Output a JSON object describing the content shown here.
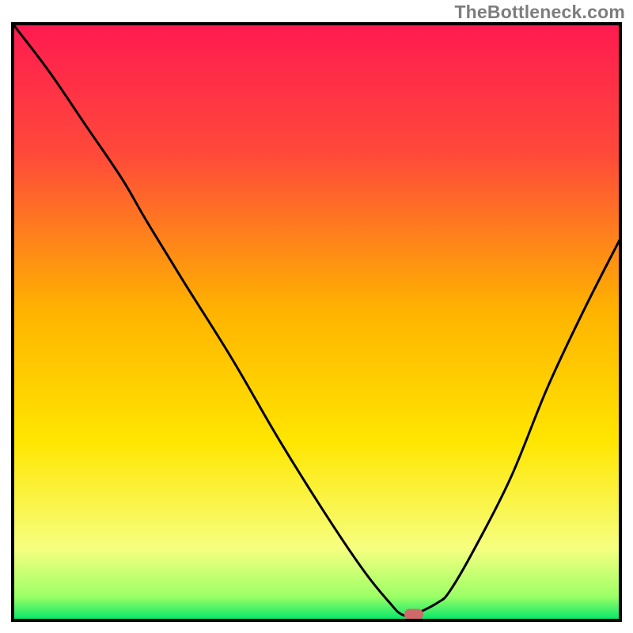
{
  "watermark": "TheBottleneck.com",
  "chart_data": {
    "type": "line",
    "title": "",
    "xlabel": "",
    "ylabel": "",
    "xlim": [
      0,
      100
    ],
    "ylim": [
      0,
      100
    ],
    "background": {
      "kind": "vertical-gradient",
      "stops": [
        {
          "pct": 0,
          "color": "#ff1a50"
        },
        {
          "pct": 22,
          "color": "#ff4a3a"
        },
        {
          "pct": 48,
          "color": "#ffb300"
        },
        {
          "pct": 70,
          "color": "#ffe600"
        },
        {
          "pct": 88,
          "color": "#f6ff80"
        },
        {
          "pct": 96,
          "color": "#9cff66"
        },
        {
          "pct": 100,
          "color": "#00e66b"
        }
      ]
    },
    "series": [
      {
        "name": "bottleneck-curve",
        "color": "#000000",
        "x": [
          0,
          6,
          12,
          18,
          22,
          28,
          36,
          44,
          52,
          58,
          62,
          64,
          66,
          70,
          72,
          76,
          82,
          88,
          94,
          100
        ],
        "y": [
          100,
          92,
          83,
          74,
          67,
          57,
          44,
          30,
          17,
          8,
          3,
          1,
          1,
          3,
          5,
          12,
          24,
          39,
          52,
          64
        ]
      }
    ],
    "marker": {
      "name": "optimal-point",
      "x": 66,
      "y": 1,
      "color": "#d06a6a",
      "rx": 12,
      "ry": 7
    },
    "axes": {
      "frame_color": "#000000",
      "frame_width": 4,
      "tick_count_x": 0,
      "tick_count_y": 0
    }
  }
}
